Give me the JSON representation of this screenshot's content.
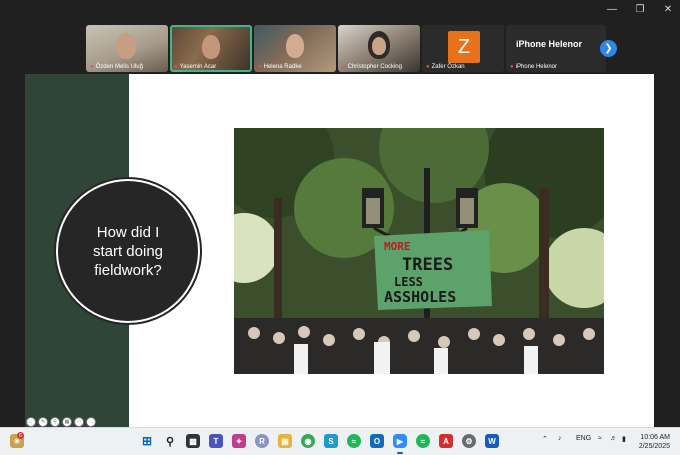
{
  "participants": [
    {
      "name": "Özden Melis Uluğ"
    },
    {
      "name": "Yasemin Acar"
    },
    {
      "name": "Helena Radke"
    },
    {
      "name": "Christopher Cocking"
    },
    {
      "name": "Zafer Özkan",
      "initial": "Z"
    },
    {
      "name": "iPhone Helenor",
      "display": "iPhone Helenor"
    }
  ],
  "slide": {
    "question": "How did I start doing fieldwork?",
    "sign_text": "MORE TREES LESS ASSHOLES"
  },
  "taskbar": {
    "lang": "ENG",
    "time": "10:06 AM",
    "date": "2/25/2025",
    "notification_count": "6"
  },
  "colors": {
    "sidebar": "#2f4538",
    "active_tile": "#3fb68a",
    "accent": "#0067c0"
  }
}
